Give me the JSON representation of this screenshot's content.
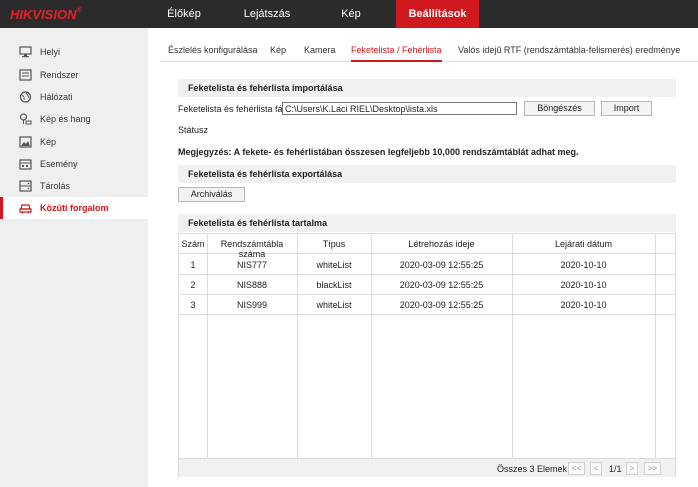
{
  "brand": {
    "name": "HIKVISION",
    "registered": "®",
    "color": "#e5212a"
  },
  "topnav": [
    {
      "label": "Élőkép",
      "active": false
    },
    {
      "label": "Lejátszás",
      "active": false
    },
    {
      "label": "Kép",
      "active": false
    },
    {
      "label": "Beállítások",
      "active": true
    }
  ],
  "sidebar": [
    {
      "label": "Helyi",
      "icon": "monitor-icon"
    },
    {
      "label": "Rendszer",
      "icon": "system-icon"
    },
    {
      "label": "Hálózati",
      "icon": "globe-icon"
    },
    {
      "label": "Kép és hang",
      "icon": "camera-audio-icon"
    },
    {
      "label": "Kép",
      "icon": "image-icon"
    },
    {
      "label": "Esemény",
      "icon": "calendar-icon"
    },
    {
      "label": "Tárolás",
      "icon": "storage-icon"
    },
    {
      "label": "Közúti forgalom",
      "icon": "traffic-car-icon",
      "active": true
    }
  ],
  "tabs": [
    {
      "label": "Észlelés konfigurálása"
    },
    {
      "label": "Kép"
    },
    {
      "label": "Kamera"
    },
    {
      "label": "Feketelista / Fehérlista",
      "active": true
    },
    {
      "label": "Valós idejű RTF (rendszámtábla-felismerés) eredménye"
    }
  ],
  "import_section": {
    "title": "Feketelista és fehérlista importálása",
    "file_label": "Feketelista és fehérlista fájl",
    "file_value": "C:\\Users\\K.Laci RIEL\\Desktop\\lista.xls",
    "browse_label": "Böngészés",
    "import_label": "Import",
    "status_label": "Státusz"
  },
  "note": "Megjegyzés: A fekete- és fehérlistában összesen legfeljebb 10,000 rendszámtáblát adhat meg.",
  "export_section": {
    "title": "Feketelista és fehérlista exportálása",
    "archive_label": "Archiválás"
  },
  "content_section": {
    "title": "Feketelista és fehérlista tartalma",
    "columns": [
      "Szám",
      "Rendszámtábla száma",
      "Típus",
      "Létrehozás ideje",
      "Lejárati dátum"
    ],
    "rows": [
      {
        "num": "1",
        "plate": "NIS777",
        "type": "whiteList",
        "created": "2020-03-09 12:55:25",
        "expires": "2020-10-10"
      },
      {
        "num": "2",
        "plate": "NIS888",
        "type": "blackList",
        "created": "2020-03-09 12:55:25",
        "expires": "2020-10-10"
      },
      {
        "num": "3",
        "plate": "NIS999",
        "type": "whiteList",
        "created": "2020-03-09 12:55:25",
        "expires": "2020-10-10"
      }
    ],
    "pagination": {
      "total": "Összes 3 Elemek",
      "first": "<<",
      "prev": "<",
      "page": "1/1",
      "next": ">",
      "last": ">>"
    }
  },
  "colors": {
    "accent": "#d0181f",
    "topbar": "#2b2b2b",
    "sidebar": "#efefef",
    "section_head": "#f1f1f1"
  }
}
